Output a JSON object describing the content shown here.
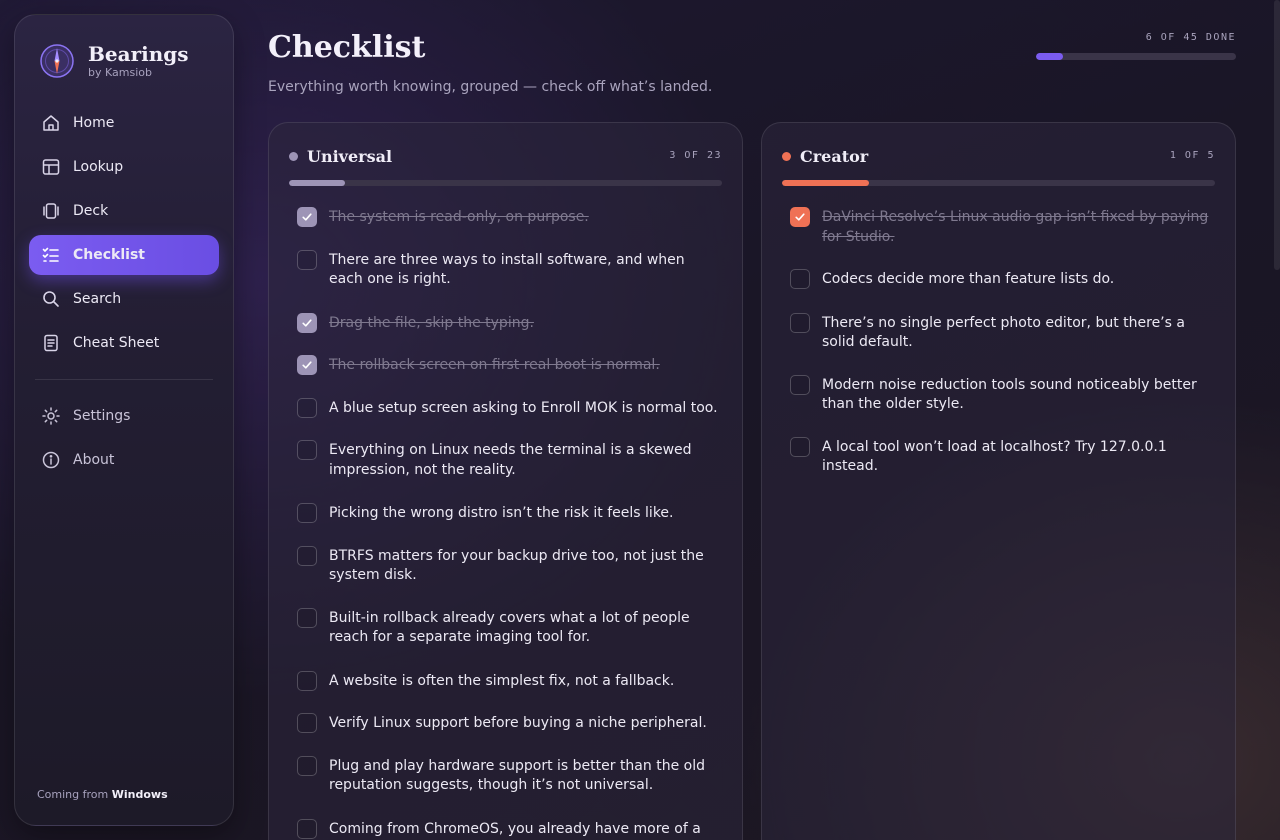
{
  "app": {
    "name": "Bearings",
    "byline": "by Kamsiob",
    "footer_prefix": "Coming from",
    "footer_os": "Windows"
  },
  "nav": {
    "primary": [
      {
        "label": "Home",
        "icon": "home-icon",
        "active": false
      },
      {
        "label": "Lookup",
        "icon": "table-icon",
        "active": false
      },
      {
        "label": "Deck",
        "icon": "cards-icon",
        "active": false
      },
      {
        "label": "Checklist",
        "icon": "checklist-icon",
        "active": true
      },
      {
        "label": "Search",
        "icon": "search-icon",
        "active": false
      },
      {
        "label": "Cheat Sheet",
        "icon": "document-icon",
        "active": false
      }
    ],
    "secondary": [
      {
        "label": "Settings",
        "icon": "gear-icon"
      },
      {
        "label": "About",
        "icon": "info-icon"
      }
    ]
  },
  "header": {
    "title": "Checklist",
    "subtitle": "Everything worth knowing, grouped — check off what’s landed.",
    "progress_label": "6 OF 45 DONE",
    "progress_value": 0.133
  },
  "colors": {
    "accent": "#7b5cf0",
    "universal": "#9d94b6",
    "creator": "#ef7155"
  },
  "groups": [
    {
      "key": "universal",
      "title": "Universal",
      "count": "3 OF 23",
      "progress": 0.13,
      "items": [
        {
          "text": "The system is read-only, on purpose.",
          "done": true
        },
        {
          "text": "There are three ways to install software, and when each one is right.",
          "done": false
        },
        {
          "text": "Drag the file, skip the typing.",
          "done": true
        },
        {
          "text": "The rollback screen on first real boot is normal.",
          "done": true
        },
        {
          "text": "A blue setup screen asking to Enroll MOK is normal too.",
          "done": false
        },
        {
          "text": "Everything on Linux needs the terminal is a skewed impression, not the reality.",
          "done": false
        },
        {
          "text": "Picking the wrong distro isn’t the risk it feels like.",
          "done": false
        },
        {
          "text": "BTRFS matters for your backup drive too, not just the system disk.",
          "done": false
        },
        {
          "text": "Built-in rollback already covers what a lot of people reach for a separate imaging tool for.",
          "done": false
        },
        {
          "text": "A website is often the simplest fix, not a fallback.",
          "done": false
        },
        {
          "text": "Verify Linux support before buying a niche peripheral.",
          "done": false
        },
        {
          "text": "Plug and play hardware support is better than the old reputation suggests, though it’s not universal.",
          "done": false
        },
        {
          "text": "Coming from ChromeOS, you already have more of a head start than it feels like.",
          "done": false
        }
      ]
    },
    {
      "key": "creator",
      "title": "Creator",
      "count": "1 OF 5",
      "progress": 0.2,
      "items": [
        {
          "text": "DaVinci Resolve’s Linux audio gap isn’t fixed by paying for Studio.",
          "done": true
        },
        {
          "text": "Codecs decide more than feature lists do.",
          "done": false
        },
        {
          "text": "There’s no single perfect photo editor, but there’s a solid default.",
          "done": false
        },
        {
          "text": "Modern noise reduction tools sound noticeably better than the older style.",
          "done": false
        },
        {
          "text": "A local tool won’t load at localhost? Try 127.0.0.1 instead.",
          "done": false
        }
      ]
    }
  ]
}
